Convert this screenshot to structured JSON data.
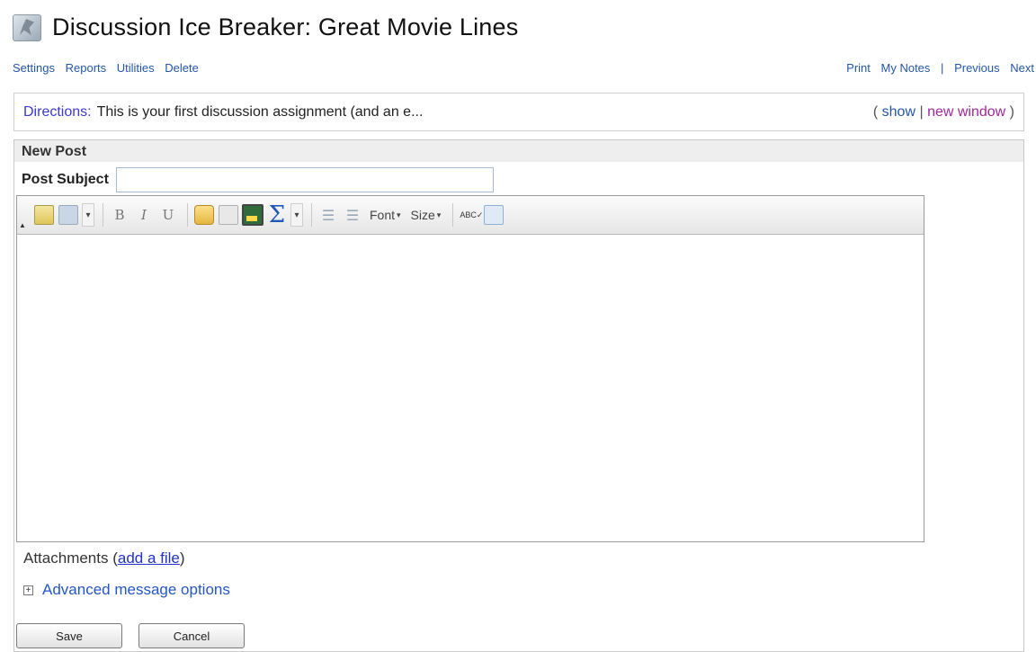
{
  "page": {
    "title": "Discussion Ice Breaker: Great Movie Lines"
  },
  "nav": {
    "left": [
      "Settings",
      "Reports",
      "Utilities",
      "Delete"
    ],
    "right": {
      "print": "Print",
      "notes": "My Notes",
      "divider": "|",
      "previous": "Previous",
      "next": "Next"
    }
  },
  "directions": {
    "label": "Directions:",
    "text": "This is your first discussion assignment (and an e...",
    "open_paren": "(",
    "show": "show",
    "divider": "|",
    "new_window": "new window",
    "close_paren": ")"
  },
  "post": {
    "header": "New Post",
    "subject_label": "Post Subject",
    "subject_value": ""
  },
  "toolbar": {
    "bold": "B",
    "italic": "I",
    "underline": "U",
    "font": "Font",
    "size": "Size",
    "icons": [
      "paste-icon",
      "copy-icon",
      "bold-icon",
      "italic-icon",
      "underline-icon",
      "folder-icon",
      "page-icon",
      "image-icon",
      "sigma-icon",
      "numbered-list-icon",
      "bullet-list-icon",
      "spellcheck-icon",
      "document-icon"
    ]
  },
  "attachments": {
    "label": "Attachments (",
    "link": "add a file",
    "suffix": ")"
  },
  "advanced": {
    "label": "Advanced message options",
    "expand": "+"
  },
  "buttons": {
    "save": "Save",
    "cancel": "Cancel"
  }
}
